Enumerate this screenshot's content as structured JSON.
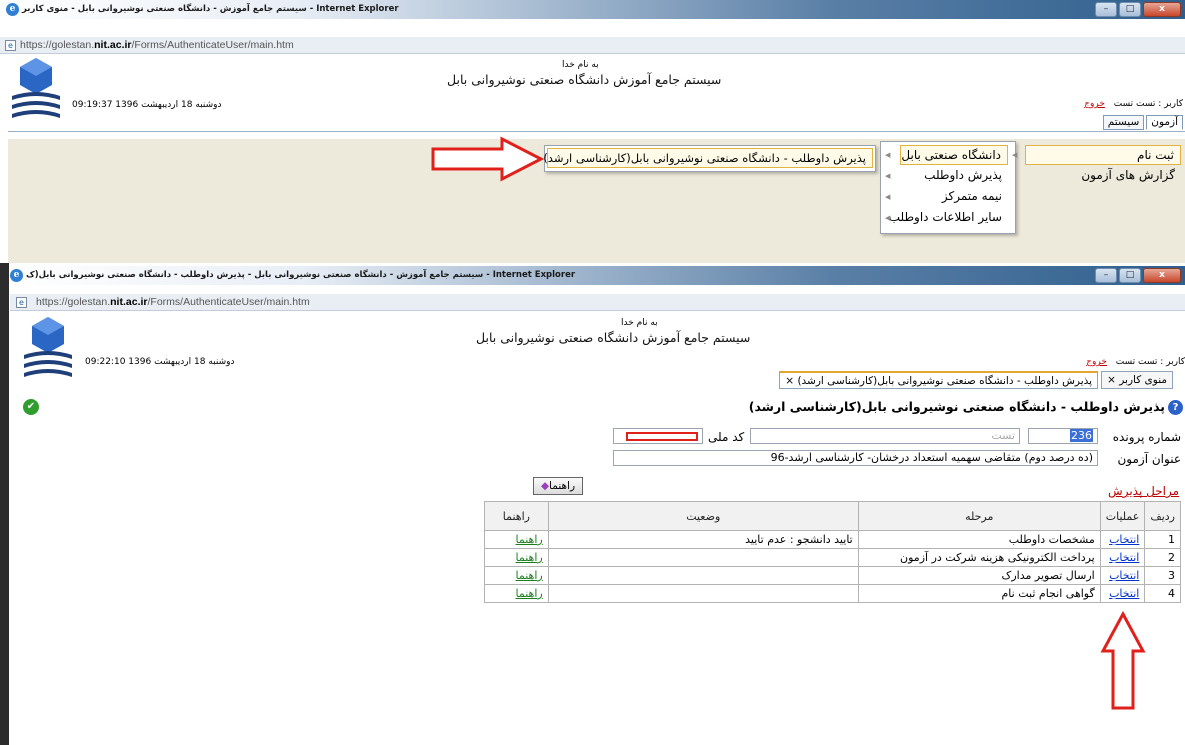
{
  "window1": {
    "title": "سیستم جامع آموزش - دانشگاه صنعتی نوشیروانی بابل - منوی کاربر - Internet Explorer",
    "url_prefix": "https://golestan.",
    "url_domain": "nit.ac.ir",
    "url_path": "/Forms/AuthenticateUser/main.htm",
    "controls": {
      "minimize": "–",
      "maximize": "□",
      "close": "x"
    }
  },
  "window2": {
    "title": "سیستم جامع آموزش - دانشگاه صنعتی نوشیروانی بابل - پذیرش داوطلب - دانشگاه صنعتی نوشیروانی بابل(ک - Internet Explorer",
    "url_prefix": "https://golestan.",
    "url_domain": "nit.ac.ir",
    "url_path": "/Forms/AuthenticateUser/main.htm",
    "controls": {
      "minimize": "–",
      "maximize": "□",
      "close": "x"
    }
  },
  "header1": {
    "bismillah": "به نام خدا",
    "system_title": "سیستم جامع آموزش   دانشگاه صنعتی نوشیروانی بابل",
    "datetime": "09:19:37 دوشنبه 18 اردیبهشت 1396",
    "user_label": "کاربر : تست تست",
    "logout": "خروج",
    "tabs": [
      "آزمون",
      "سیستم"
    ]
  },
  "menu": {
    "level1": [
      "ثبت نام",
      "گزارش های آزمون"
    ],
    "level2": [
      "دانشگاه صنعتی بابل",
      "پذیرش داوطلب",
      "نیمه متمرکز",
      "سایر اطلاعات داوطلب"
    ],
    "level3": [
      "پذیرش داوطلب - دانشگاه صنعتی نوشیروانی بابل(کارشناسی ارشد)"
    ]
  },
  "header2": {
    "bismillah": "به نام خدا",
    "system_title": "سیستم جامع آموزش   دانشگاه صنعتی نوشیروانی بابل",
    "datetime": "09:22:10 دوشنبه 18 اردیبهشت 1396",
    "user_label": "کاربر : تست تست",
    "logout": "خروج",
    "tabs": [
      "منوی کاربر",
      "پذیرش داوطلب - دانشگاه صنعتی نوشیروانی بابل(کارشناسی ارشد)"
    ],
    "close_glyph": "×"
  },
  "form": {
    "page_title": "پذیرش داوطلب - دانشگاه صنعتی نوشیروانی بابل(کارشناسی ارشد)",
    "help_glyph": "?",
    "case_number_label": "شماره پرونده",
    "case_number_value": "236",
    "name_value": "تست",
    "national_code_label": "کد ملی",
    "exam_title_label": "عنوان آزمون",
    "exam_title_value": "(ده درصد دوم) متقاضی سهمیه استعداد درخشان- کارشناسی ارشد-96",
    "stages_link": "مراحل پذیرش",
    "help_button": "راهنما"
  },
  "table": {
    "headers": [
      "ردیف",
      "عملیات",
      "مرحله",
      "وضعیت",
      "راهنما"
    ],
    "rows": [
      {
        "num": "1",
        "action": "انتخاب",
        "stage": "مشخصات داوطلب",
        "status": "تایید دانشجو : عدم تایید",
        "help": "راهنما"
      },
      {
        "num": "2",
        "action": "انتخاب",
        "stage": "پرداخت الکترونیکی هزینه شرکت در آزمون",
        "status": "",
        "help": "راهنما"
      },
      {
        "num": "3",
        "action": "انتخاب",
        "stage": "ارسال تصویر مدارک",
        "status": "",
        "help": "راهنما"
      },
      {
        "num": "4",
        "action": "انتخاب",
        "stage": "گواهی انجام ثبت نام",
        "status": "",
        "help": "راهنما"
      }
    ]
  },
  "status_icon": "✔",
  "colors": {
    "arrow": "#e0211b",
    "menu_band": "#eeeadb",
    "link_red": "#c00000",
    "link_green": "#1a7f1a",
    "link_blue": "#0033cc"
  }
}
